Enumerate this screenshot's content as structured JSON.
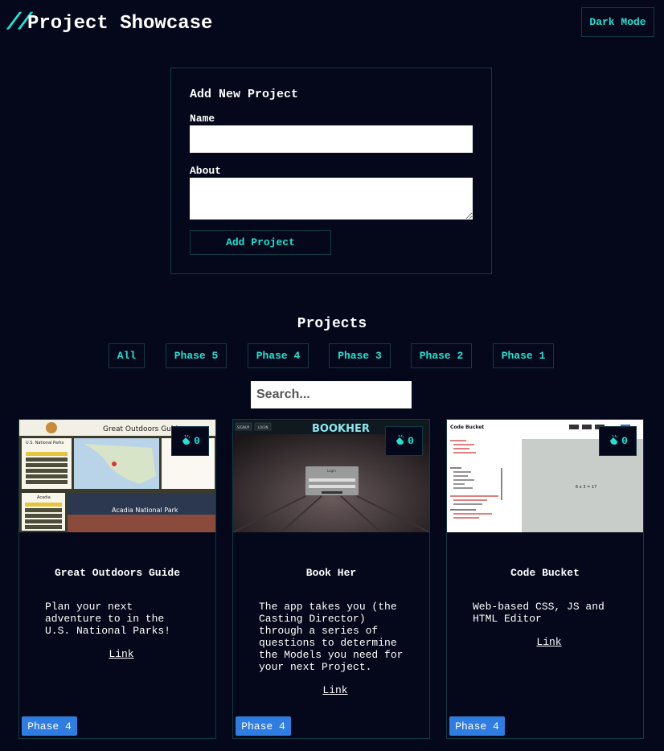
{
  "header": {
    "logo": "//",
    "title": "Project Showcase",
    "dark_mode_label": "Dark Mode"
  },
  "form": {
    "title": "Add New Project",
    "name_label": "Name",
    "name_value": "",
    "about_label": "About",
    "about_value": "",
    "submit_label": "Add Project"
  },
  "projects": {
    "heading": "Projects",
    "filters": [
      "All",
      "Phase 5",
      "Phase 4",
      "Phase 3",
      "Phase 2",
      "Phase 1"
    ],
    "search_placeholder": "Search...",
    "cards": [
      {
        "title": "Great Outdoors Guide",
        "about": "Plan your next\nadventure to in the\nU.S. National Parks!",
        "link": "Link",
        "likes": "0",
        "phase": "Phase 4",
        "thumb": {
          "site_name": "Great Outdoors Guide",
          "sidebar_title": "U.S. National Parks",
          "park_name": "Acadia National Park",
          "tab_label": "Acadia"
        }
      },
      {
        "title": "Book Her",
        "about": "The app takes you (the\nCasting Director)\nthrough a series of\nquestions to determine\nthe Models you need for\nyour next Project.",
        "link": "Link",
        "likes": "0",
        "phase": "Phase 4",
        "thumb": {
          "logo": "BOOKHER",
          "nav_signup": "SIGNUP",
          "nav_login": "LOGIN",
          "dialog_title": "Login"
        }
      },
      {
        "title": "Code Bucket",
        "about": "Web-based CSS, JS and\nHTML Editor",
        "link": "Link",
        "likes": "0",
        "phase": "Phase 4",
        "thumb": {
          "app_name": "Code Bucket",
          "preview_text": "6 x 3 = 17"
        }
      }
    ]
  },
  "colors": {
    "background": "#05081a",
    "accent": "#20e3d3",
    "border": "#123a44",
    "badge": "#2f7de1"
  },
  "icons": {
    "likes": "clap-icon"
  }
}
